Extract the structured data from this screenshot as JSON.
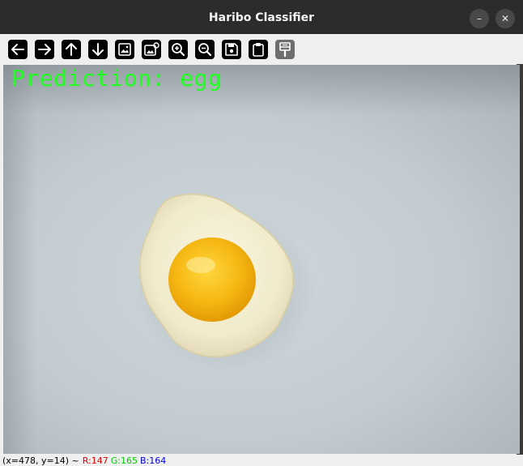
{
  "window": {
    "title": "Haribo Classifier",
    "minimize_icon": "minimize-icon",
    "close_icon": "close-icon",
    "minimize_glyph": "–",
    "close_glyph": "✕"
  },
  "toolbar": {
    "buttons": [
      {
        "name": "pan-left-button",
        "icon": "arrow-left-icon"
      },
      {
        "name": "pan-right-button",
        "icon": "arrow-right-icon"
      },
      {
        "name": "pan-up-button",
        "icon": "arrow-up-icon"
      },
      {
        "name": "pan-down-button",
        "icon": "arrow-down-icon"
      },
      {
        "name": "zoom-original-button",
        "icon": "image-icon"
      },
      {
        "name": "zoom-fit-button",
        "icon": "image-adjust-icon"
      },
      {
        "name": "zoom-in-button",
        "icon": "zoom-in-icon"
      },
      {
        "name": "zoom-out-button",
        "icon": "zoom-out-icon"
      },
      {
        "name": "save-button",
        "icon": "save-icon"
      },
      {
        "name": "copy-clipboard-button",
        "icon": "clipboard-icon"
      },
      {
        "name": "properties-button",
        "icon": "paint-icon",
        "disabled": true
      }
    ]
  },
  "image": {
    "overlay_text": "Prediction: egg",
    "overlay_color": "#1fff1f",
    "subject": "fried-egg gummy on light background"
  },
  "status": {
    "position": "(x=478, y=14) ~",
    "r": "R:147",
    "g": "G:165",
    "b": "B:164"
  }
}
